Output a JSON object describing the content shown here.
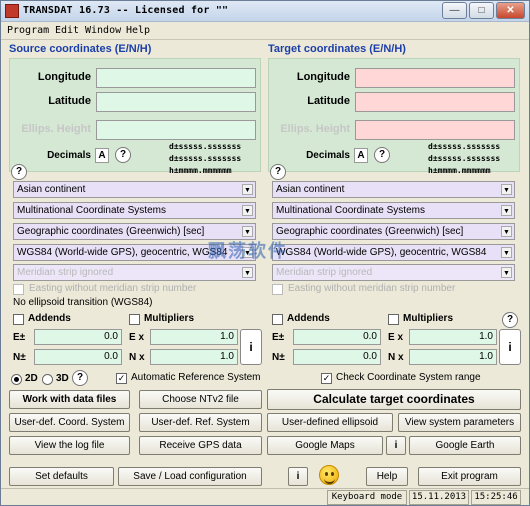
{
  "titlebar": {
    "title": "TRANSDAT 16.73 -- Licensed for \"\"",
    "min": "—",
    "max": "□",
    "close": "✕"
  },
  "menu": [
    "Program",
    "Edit",
    "Window",
    "Help"
  ],
  "source": {
    "header": "Source coordinates (E/N/H)",
    "longitude": "Longitude",
    "latitude": "Latitude",
    "ellips": "Ellips. Height",
    "decimals_label": "Decimals",
    "decimals_value": "A",
    "fmt1": "d±sssss.sssssss",
    "fmt2": "d±sssss.sssssss",
    "fmt3": "h±mmmm.mmmmmm",
    "region": "Asian continent",
    "system_group": "Multinational Coordinate Systems",
    "coord_type": "Geographic coordinates (Greenwich) [sec]",
    "datum": "WGS84 (World-wide GPS), geocentric, WGS84",
    "meridian": "Meridian strip ignored",
    "easting_label": "Easting without meridian strip number",
    "ellipsoid_transition": "No ellipsoid transition (WGS84)",
    "addends": "Addends",
    "multipliers": "Multipliers",
    "e_label": "E±",
    "n_label": "N±",
    "ex_label": "E x",
    "nx_label": "N x",
    "e_add": "0.0",
    "n_add": "0.0",
    "e_mul": "1.0",
    "n_mul": "1.0"
  },
  "target": {
    "header": "Target coordinates (E/N/H)",
    "longitude": "Longitude",
    "latitude": "Latitude",
    "ellips": "Ellips. Height",
    "decimals_label": "Decimals",
    "decimals_value": "A",
    "fmt1": "d±sssss.sssssss",
    "fmt2": "d±sssss.sssssss",
    "fmt3": "h±mmmm.mmmmmm",
    "region": "Asian continent",
    "system_group": "Multinational Coordinate Systems",
    "coord_type": "Geographic coordinates (Greenwich) [sec]",
    "datum": "WGS84 (World-wide GPS), geocentric, WGS84",
    "meridian": "Meridian strip ignored",
    "easting_label": "Easting without meridian strip number",
    "addends": "Addends",
    "multipliers": "Multipliers",
    "e_label": "E±",
    "n_label": "N±",
    "ex_label": "E x",
    "nx_label": "N x",
    "e_add": "0.0",
    "n_add": "0.0",
    "e_mul": "1.0",
    "n_mul": "1.0"
  },
  "options": {
    "r2d": "2D",
    "r3d": "3D",
    "auto_ref": "Automatic Reference System",
    "check_range": "Check Coordinate System range"
  },
  "buttons": {
    "work_files": "Work with data files",
    "choose_ntv2": "Choose NTv2 file",
    "calc_target": "Calculate target coordinates",
    "user_coord": "User-def. Coord. System",
    "user_ref": "User-def. Ref. System",
    "user_ellipsoid": "User-defined ellipsoid",
    "view_params": "View system parameters",
    "view_log": "View the log file",
    "receive_gps": "Receive GPS data",
    "google_maps": "Google Maps",
    "google_earth": "Google Earth",
    "set_defaults": "Set defaults",
    "save_load": "Save / Load configuration",
    "help": "Help",
    "exit": "Exit program",
    "info": "i",
    "q": "?"
  },
  "status": {
    "mode": "Keyboard mode",
    "date": "15.11.2013",
    "time": "15:25:46"
  },
  "watermark": "飘荡软件"
}
